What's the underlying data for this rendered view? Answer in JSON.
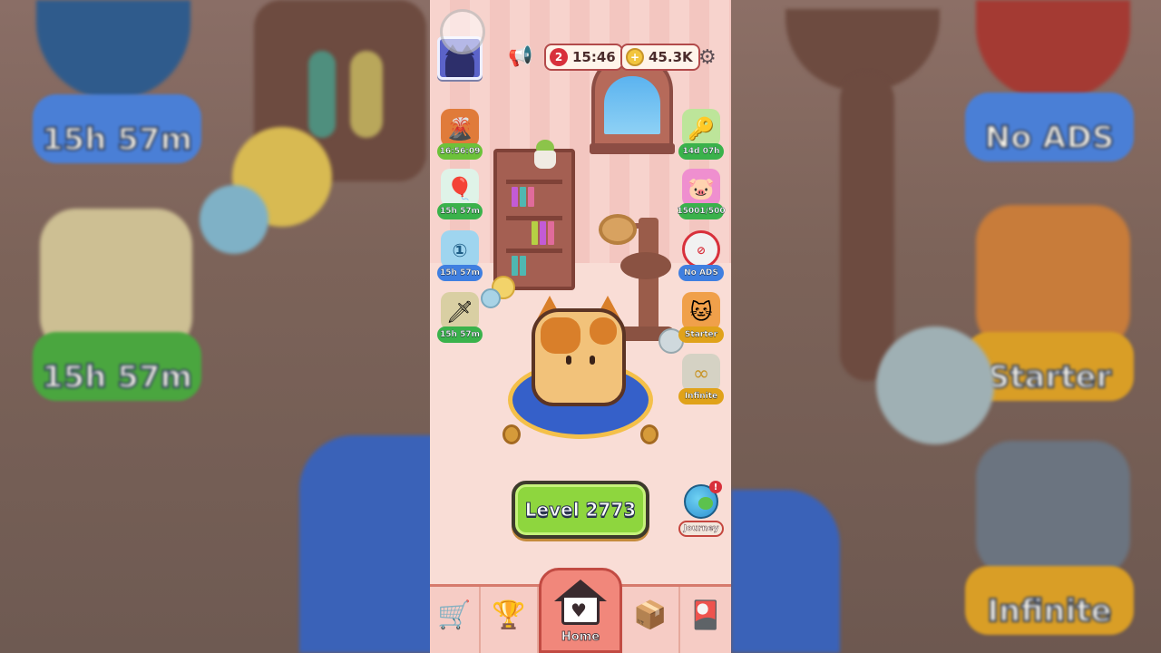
{
  "status_bar": {
    "hearts_count": "2",
    "timer": "15:46",
    "coins": "45.3K"
  },
  "left_offers": [
    {
      "label": "16:56:09",
      "icon": "volcano-icon",
      "caption_color": "#6cc23a"
    },
    {
      "label": "15h 57m",
      "icon": "cat-balloon-icon",
      "caption_color": "#3ab24b"
    },
    {
      "label": "15h 57m",
      "icon": "number-one-cat-icon",
      "caption_color": "#3f7fe0"
    },
    {
      "label": "15h 57m",
      "icon": "knight-cat-icon",
      "caption_color": "#3ab24b"
    }
  ],
  "right_offers": [
    {
      "label": "14d 07h",
      "icon": "golden-key-icon",
      "caption_color": "#3ab24b"
    },
    {
      "label": "15001/500",
      "icon": "piggy-bank-cat-icon",
      "caption_color": "#3ab24b"
    },
    {
      "label": "No ADS",
      "icon": "no-ads-icon",
      "caption_color": "#3f7fe0"
    },
    {
      "label": "Starter",
      "icon": "calico-cat-icon",
      "caption_color": "#e0a21a"
    },
    {
      "label": "Infinite",
      "icon": "infinite-ticket-icon",
      "caption_color": "#e0a21a"
    }
  ],
  "level_button": {
    "label": "Level 2773"
  },
  "journey": {
    "label": "Journey",
    "badge": "!"
  },
  "bottom_nav": {
    "home_label": "Home",
    "items": [
      {
        "name": "shop",
        "icon": "shopping-cart-icon"
      },
      {
        "name": "trophy",
        "icon": "trophy-icon"
      },
      {
        "name": "home",
        "icon": "home-icon"
      },
      {
        "name": "collection",
        "icon": "cat-box-icon"
      },
      {
        "name": "cards",
        "icon": "cards-icon"
      }
    ]
  },
  "background_tags": {
    "top_left": "15h 57m",
    "mid_left": "15h 57m",
    "top_right": "No ADS",
    "mid_right": "Starter",
    "bottom_right": "Infinite"
  },
  "colors": {
    "accent_green": "#8ed63e",
    "nav_active": "#f1877b",
    "wall_pink": "#f7d3cd"
  }
}
